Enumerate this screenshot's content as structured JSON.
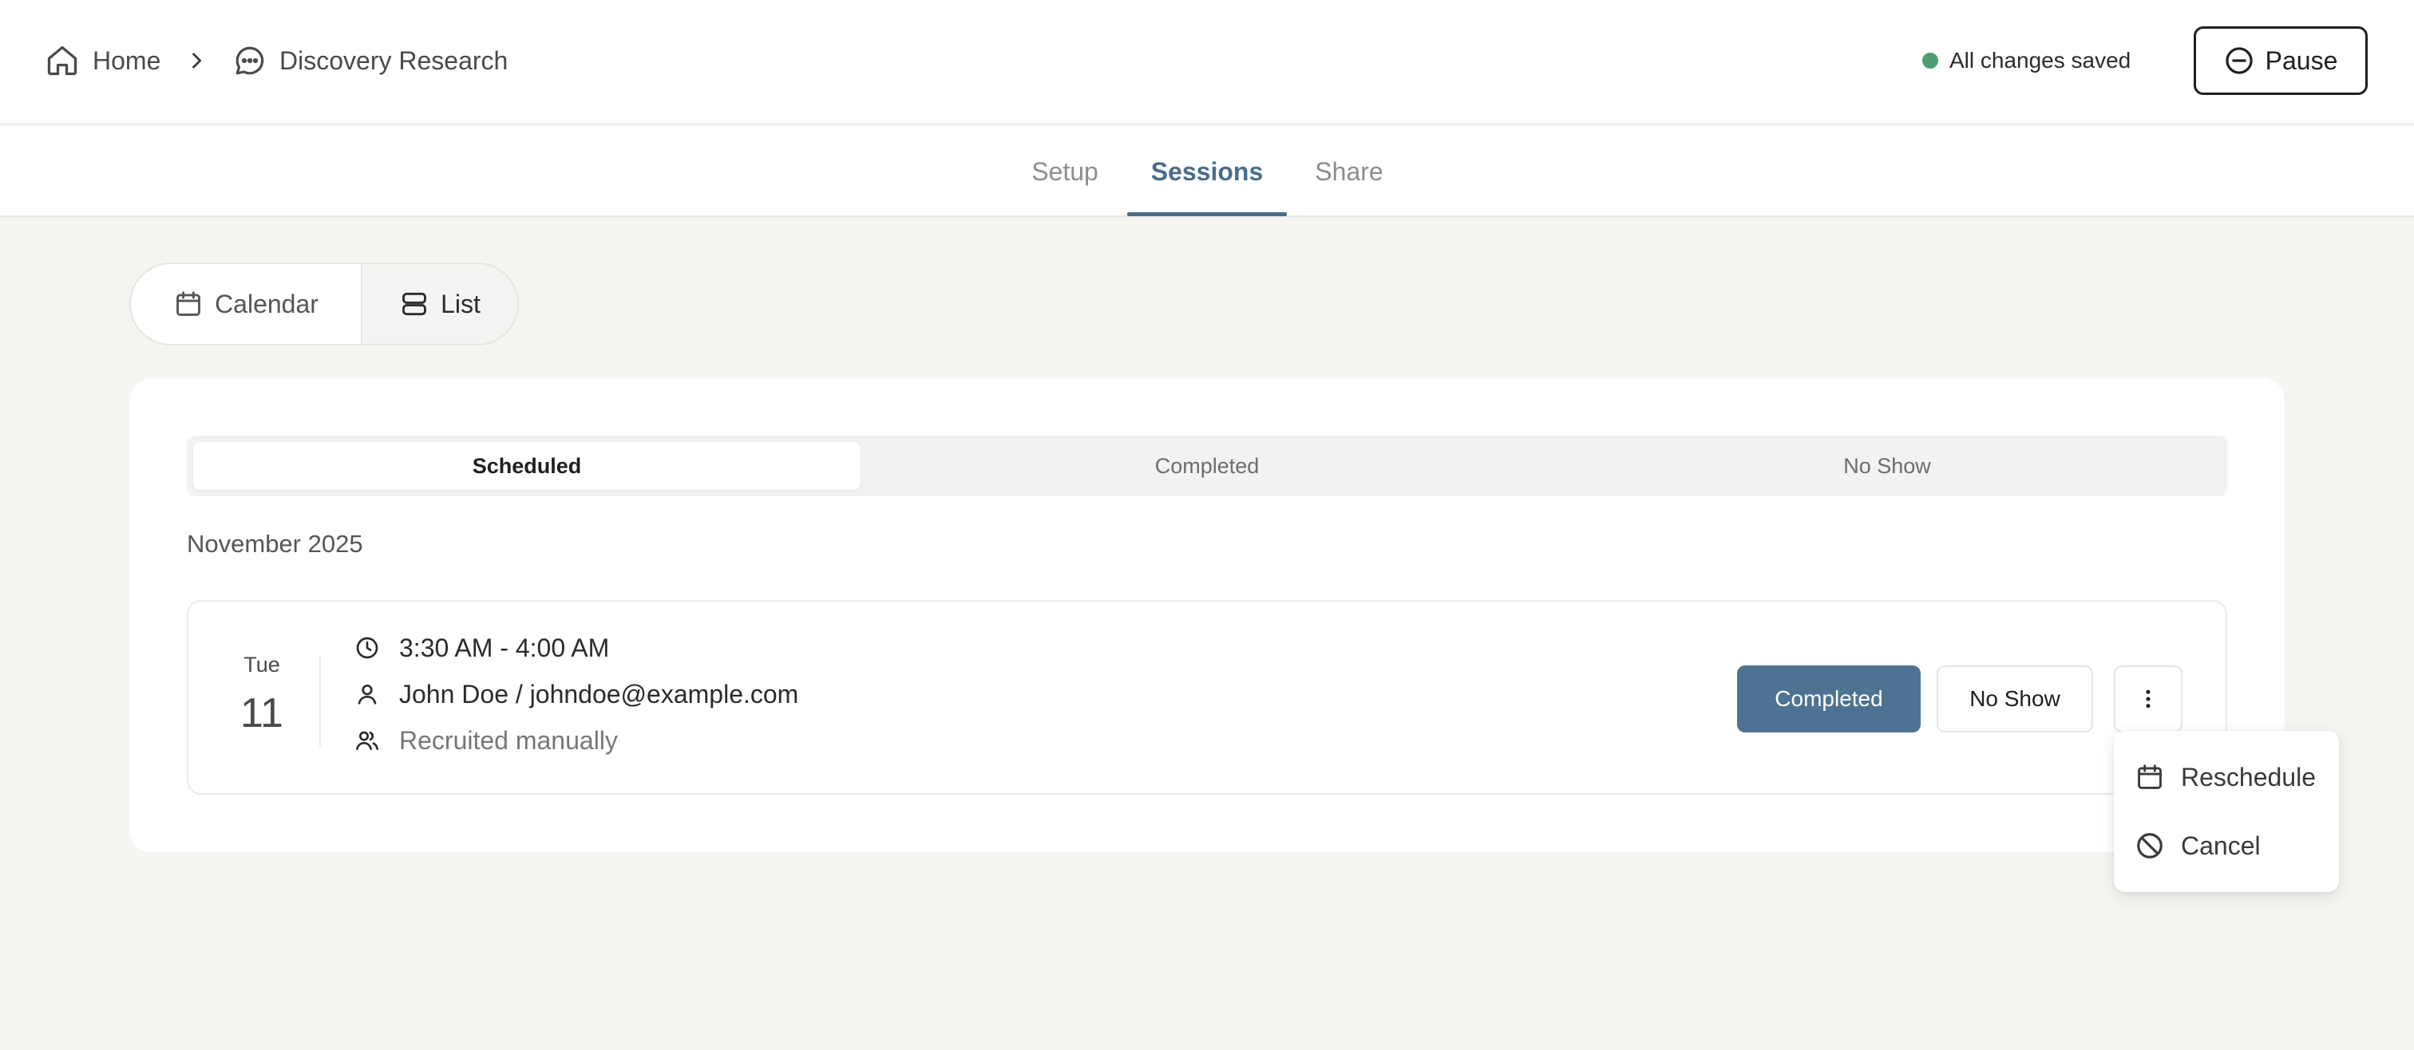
{
  "breadcrumb": {
    "home_label": "Home",
    "project_label": "Discovery Research"
  },
  "header": {
    "save_status": "All changes saved",
    "pause_label": "Pause"
  },
  "tabs": [
    {
      "label": "Setup",
      "active": false
    },
    {
      "label": "Sessions",
      "active": true
    },
    {
      "label": "Share",
      "active": false
    }
  ],
  "view_toggle": {
    "calendar_label": "Calendar",
    "list_label": "List",
    "selected": "List"
  },
  "status_filter": [
    {
      "label": "Scheduled",
      "active": true
    },
    {
      "label": "Completed",
      "active": false
    },
    {
      "label": "No Show",
      "active": false
    }
  ],
  "month_label": "November 2025",
  "session": {
    "weekday": "Tue",
    "day": "11",
    "time": "3:30 AM - 4:00 AM",
    "participant": "John Doe / johndoe@example.com",
    "recruitment": "Recruited manually",
    "completed_label": "Completed",
    "noshow_label": "No Show"
  },
  "menu": {
    "items": [
      {
        "label": "Reschedule",
        "icon": "calendar-icon"
      },
      {
        "label": "Cancel",
        "icon": "ban-icon"
      }
    ]
  },
  "colors": {
    "accent": "#4a6d8c",
    "completed_button": "#4e7392",
    "saved_dot": "#4f9d72",
    "background": "#f6f5f2"
  }
}
